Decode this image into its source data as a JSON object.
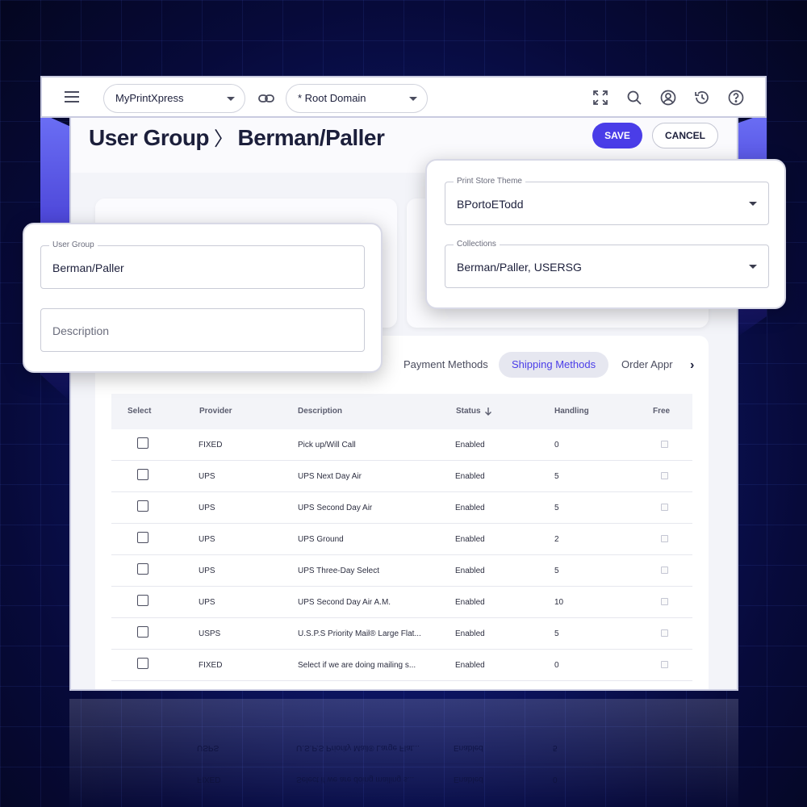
{
  "topbar": {
    "site_select": "MyPrintXpress",
    "domain_select": "* Root Domain",
    "icons": [
      "menu-icon",
      "link-icon",
      "fullscreen-icon",
      "search-icon",
      "user-icon",
      "history-icon",
      "help-icon"
    ]
  },
  "header": {
    "title_part1": "User Group",
    "separator": "〉",
    "title_part2": "Berman/Paller",
    "save_label": "SAVE",
    "cancel_label": "CANCEL"
  },
  "left_card": {
    "user_group_label": "User Group",
    "user_group_value": "Berman/Paller",
    "description_placeholder": "Description"
  },
  "right_card": {
    "theme_label": "Print Store Theme",
    "theme_value": "BPortoETodd",
    "collections_label": "Collections",
    "collections_value": "Berman/Paller, USERSG"
  },
  "tabs": [
    {
      "label": "Payment Methods",
      "active": false
    },
    {
      "label": "Shipping Methods",
      "active": true
    },
    {
      "label": "Order Appr",
      "active": false
    }
  ],
  "table": {
    "columns": [
      "Select",
      "Provider",
      "Description",
      "Status",
      "Handling",
      "Free"
    ],
    "rows": [
      {
        "provider": "FIXED",
        "description": "Pick up/Will Call",
        "status": "Enabled",
        "handling": "0"
      },
      {
        "provider": "UPS",
        "description": "UPS Next Day Air",
        "status": "Enabled",
        "handling": "5"
      },
      {
        "provider": "UPS",
        "description": "UPS Second Day Air",
        "status": "Enabled",
        "handling": "5"
      },
      {
        "provider": "UPS",
        "description": "UPS Ground",
        "status": "Enabled",
        "handling": "2"
      },
      {
        "provider": "UPS",
        "description": "UPS Three-Day Select",
        "status": "Enabled",
        "handling": "5"
      },
      {
        "provider": "UPS",
        "description": "UPS Second Day Air A.M.",
        "status": "Enabled",
        "handling": "10"
      },
      {
        "provider": "USPS",
        "description": "U.S.P.S Priority Mail® Large Flat...",
        "status": "Enabled",
        "handling": "5"
      },
      {
        "provider": "FIXED",
        "description": "Select if we are doing mailing s...",
        "status": "Enabled",
        "handling": "0"
      }
    ]
  },
  "colors": {
    "accent": "#4a3de8",
    "background": "#0d1666"
  }
}
